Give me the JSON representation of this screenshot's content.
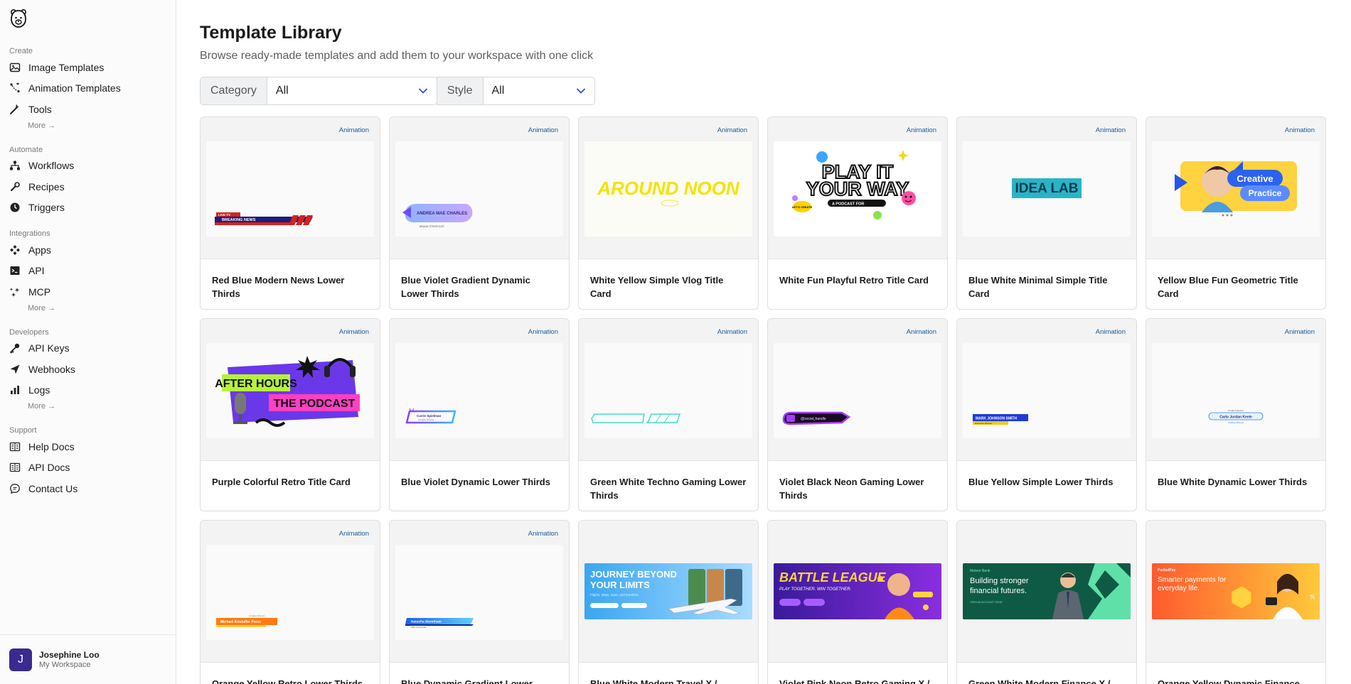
{
  "sidebar": {
    "sections": [
      {
        "title": "Create",
        "items": [
          {
            "label": "Image Templates",
            "icon": "image-icon"
          },
          {
            "label": "Animation Templates",
            "icon": "animation-icon"
          },
          {
            "label": "Tools",
            "icon": "wand-icon"
          }
        ],
        "more": "More →"
      },
      {
        "title": "Automate",
        "items": [
          {
            "label": "Workflows",
            "icon": "workflow-icon"
          },
          {
            "label": "Recipes",
            "icon": "recipe-icon"
          },
          {
            "label": "Triggers",
            "icon": "clock-icon"
          }
        ]
      },
      {
        "title": "Integrations",
        "items": [
          {
            "label": "Apps",
            "icon": "apps-icon"
          },
          {
            "label": "API",
            "icon": "terminal-icon"
          },
          {
            "label": "MCP",
            "icon": "mcp-icon"
          }
        ],
        "more": "More →"
      },
      {
        "title": "Developers",
        "items": [
          {
            "label": "API Keys",
            "icon": "key-icon"
          },
          {
            "label": "Webhooks",
            "icon": "send-icon"
          },
          {
            "label": "Logs",
            "icon": "bar-chart-icon"
          }
        ],
        "more": "More →"
      },
      {
        "title": "Support",
        "items": [
          {
            "label": "Help Docs",
            "icon": "book-icon"
          },
          {
            "label": "API Docs",
            "icon": "book-icon"
          },
          {
            "label": "Contact Us",
            "icon": "chat-icon"
          }
        ]
      }
    ],
    "user": {
      "initial": "J",
      "name": "Josephine Loo",
      "workspace": "My Workspace"
    }
  },
  "header": {
    "title": "Template Library",
    "subtitle": "Browse ready-made templates and add them to your workspace with one click"
  },
  "filters": {
    "category_label": "Category",
    "category_value": "All",
    "style_label": "Style",
    "style_value": "All"
  },
  "templates": [
    {
      "title": "Red Blue Modern News Lower Thirds",
      "badge": "Animation",
      "art": "news"
    },
    {
      "title": "Blue Violet Gradient Dynamic Lower Thirds",
      "badge": "Animation",
      "art": "gradient"
    },
    {
      "title": "White Yellow Simple Vlog Title Card",
      "badge": "Animation",
      "art": "vlog"
    },
    {
      "title": "White Fun Playful Retro Title Card",
      "badge": "Animation",
      "art": "play"
    },
    {
      "title": "Blue White Minimal Simple Title Card",
      "badge": "Animation",
      "art": "idea"
    },
    {
      "title": "Yellow Blue Fun Geometric Title Card",
      "badge": "Animation",
      "art": "creative"
    },
    {
      "title": "Purple Colorful Retro Title Card",
      "badge": "Animation",
      "art": "afterhours"
    },
    {
      "title": "Blue Violet Dynamic Lower Thirds",
      "badge": "Animation",
      "art": "bv-lower"
    },
    {
      "title": "Green White Techno Gaming Lower Thirds",
      "badge": "Animation",
      "art": "techno"
    },
    {
      "title": "Violet Black Neon Gaming Lower Thirds",
      "badge": "Animation",
      "art": "neon"
    },
    {
      "title": "Blue Yellow Simple Lower Thirds",
      "badge": "Animation",
      "art": "by-lower"
    },
    {
      "title": "Blue White Dynamic Lower Thirds",
      "badge": "Animation",
      "art": "bw-lower"
    },
    {
      "title": "Orange Yellow Retro Lower Thirds",
      "badge": "Animation",
      "art": "oy-lower"
    },
    {
      "title": "Blue Dynamic Gradient Lower",
      "badge": "Animation",
      "art": "bd-lower"
    },
    {
      "title": "Blue White Modern Travel X /",
      "badge": "",
      "art": "travel"
    },
    {
      "title": "Violet Pink Neon Retro Gaming X /",
      "badge": "",
      "art": "battle"
    },
    {
      "title": "Green White Modern Finance X /",
      "badge": "",
      "art": "finance"
    },
    {
      "title": "Orange Yellow Dynamic Finance",
      "badge": "",
      "art": "payments"
    }
  ],
  "art_text": {
    "news": [
      "LIVE TV",
      "BREAKING NEWS"
    ],
    "gradient": [
      "ANDREA MAE CHARLES",
      "BRAND STRATEGIST"
    ],
    "vlog": [
      "AROUND NOON"
    ],
    "play": [
      "PLAY IT",
      "YOUR WAY",
      "A PODCAST FOR",
      "LET'S CREATE"
    ],
    "idea": [
      "IDEA LAB"
    ],
    "creative": [
      "Creative",
      "Practice"
    ],
    "afterhours": [
      "AFTER HOURS",
      "THE PODCAST"
    ],
    "bv-lower": [
      "Carrie Spielman",
      "Creative Director"
    ],
    "neon": [
      "@social_handle"
    ],
    "by-lower": [
      "MARK JOHNSON SMITH",
      "Executive Director"
    ],
    "bw-lower": [
      "Product Director",
      "Carlo Jordan Keele",
      "Creative Director"
    ],
    "oy-lower": [
      "Creative Director",
      "Michael Kristoffer Perez"
    ],
    "bd-lower": [
      "Natasha Wennham",
      "CEO & Founder"
    ],
    "travel": [
      "JOURNEY BEYOND",
      "YOUR LIMITS",
      "Flights, stays, tours, and transfers."
    ],
    "battle": [
      "BATTLE LEAGUE",
      "PLAY TOGETHER. WIN TOGETHER."
    ],
    "finance": [
      "Meteor Bank",
      "Building stronger",
      "financial futures.",
      "OPEN AN ACCOUNT TODAY"
    ],
    "payments": [
      "PocketPay",
      "Smarter payments for",
      "everyday life."
    ]
  }
}
